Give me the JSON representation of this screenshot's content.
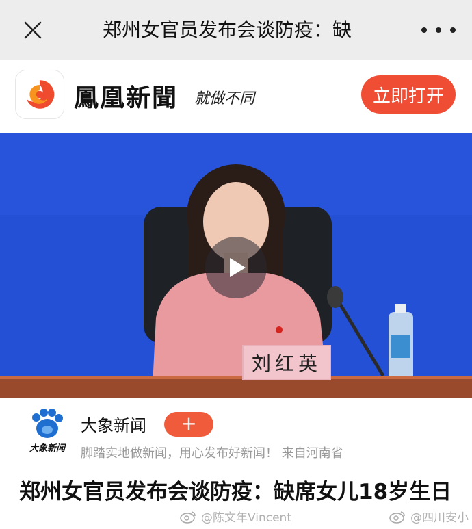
{
  "topbar": {
    "title": "郑州女官员发布会谈防疫：缺"
  },
  "brand": {
    "name": "鳳凰新聞",
    "slogan": "就做不同",
    "open_label": "立即打开"
  },
  "video": {
    "nameplate": "刘红英"
  },
  "source": {
    "logo_text": "大象新闻",
    "name": "大象新闻",
    "follow_label": "+",
    "desc": "脚踏实地做新闻，用心发布好新闻！  来自河南省"
  },
  "article": {
    "headline": "郑州女官员发布会谈防疫：缺席女儿18岁生日"
  },
  "watermarks": {
    "left": "@陈文年Vincent",
    "right": "@四川安小"
  },
  "colors": {
    "accent": "#f04d35",
    "topbar_bg": "#ededed",
    "stage_blue": "#2450d6"
  },
  "icons": {
    "close": "close-icon",
    "more": "more-icon",
    "play": "play-icon"
  }
}
